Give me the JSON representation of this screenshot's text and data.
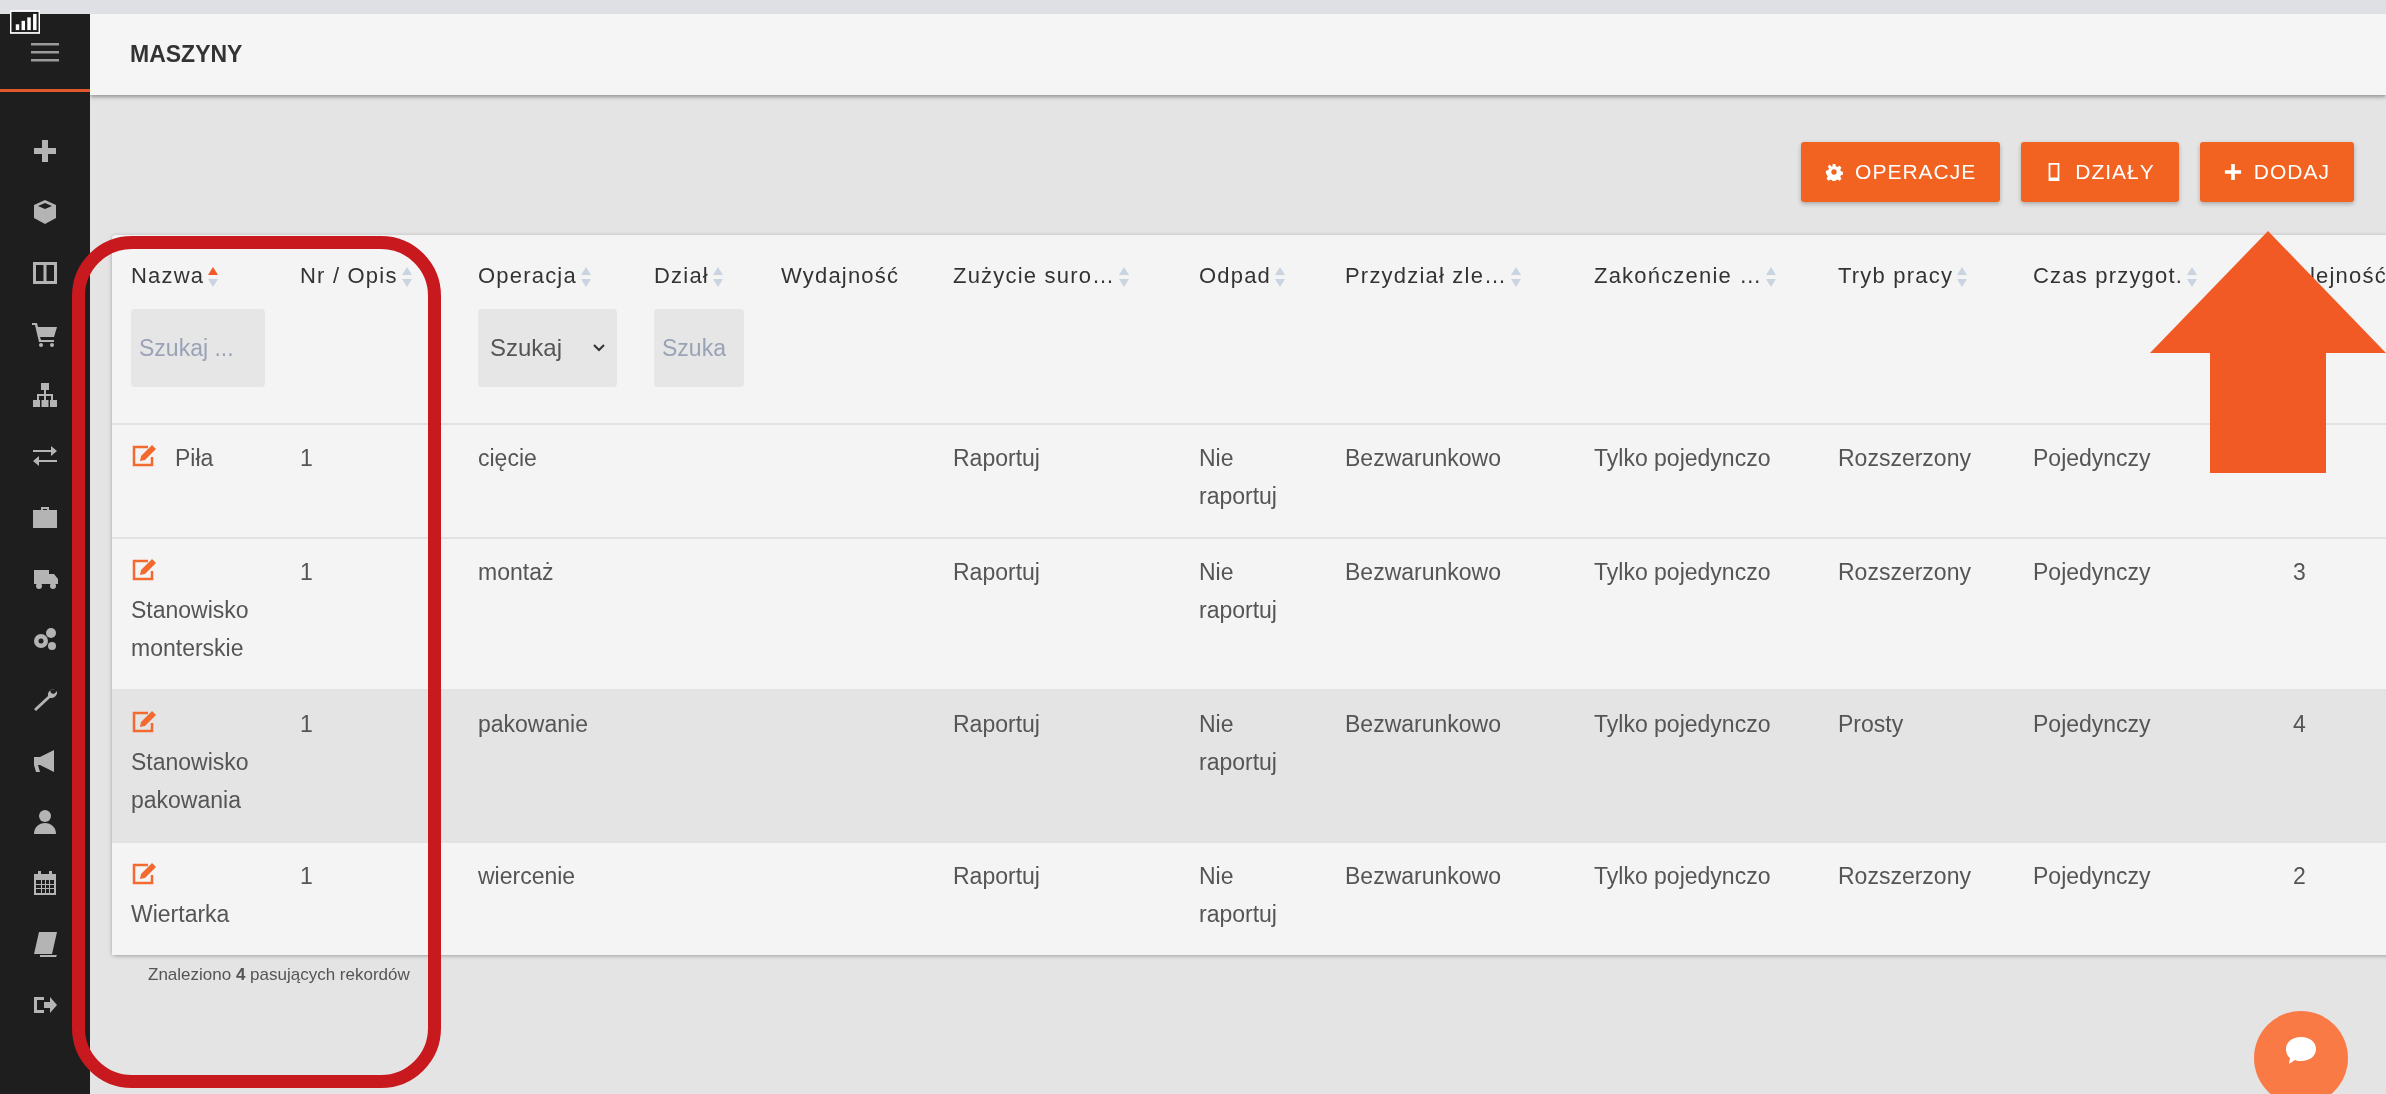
{
  "page": {
    "title": "MASZYNY"
  },
  "toolbar": {
    "buttons": [
      {
        "label": "OPERACJE",
        "kind": "gear"
      },
      {
        "label": "DZIAŁY",
        "kind": "tablet"
      },
      {
        "label": "DODAJ",
        "kind": "plus"
      }
    ]
  },
  "table": {
    "columns": [
      {
        "label": "Nazwa",
        "sorted": true,
        "filter": {
          "kind": "text",
          "placeholder": "Szukaj ..."
        }
      },
      {
        "label": "Nr / Opis",
        "sorted": false
      },
      {
        "label": "Operacja",
        "sorted": false,
        "filter": {
          "kind": "select",
          "value": "Szukaj"
        }
      },
      {
        "label": "Dział",
        "sorted": false,
        "filter": {
          "kind": "text",
          "placeholder": "Szuka"
        }
      },
      {
        "label": "Wydajność"
      },
      {
        "label": "Zużycie suro…",
        "sorted": false
      },
      {
        "label": "Odpad",
        "sorted": false
      },
      {
        "label": "Przydział zle…",
        "sorted": false
      },
      {
        "label": "Zakończenie …",
        "sorted": false
      },
      {
        "label": "Tryb pracy",
        "sorted": false
      },
      {
        "label": "Czas przygot.",
        "sorted": false
      },
      {
        "label": "lejność"
      }
    ],
    "rows": [
      {
        "highlighted": false,
        "name": "Piła",
        "nr_opis": "1",
        "operacja": "cięcie",
        "zuzycie_surowca": "Raportuj",
        "odpad": "Nie raportuj",
        "przydzial": "Bezwarunkowo",
        "zakonczenie": "Tylko pojedynczo",
        "tryb_pracy": "Rozszerzony",
        "czas_przygot": "Pojedynczy"
      },
      {
        "highlighted": false,
        "name": "Stanowisko monterskie",
        "nr_opis": "1",
        "operacja": "montaż",
        "zuzycie_surowca": "Raportuj",
        "odpad": "Nie raportuj",
        "przydzial": "Bezwarunkowo",
        "zakonczenie": "Tylko pojedynczo",
        "tryb_pracy": "Rozszerzony",
        "czas_przygot": "Pojedynczy",
        "kolejnosc": "3"
      },
      {
        "highlighted": true,
        "name": "Stanowisko pakowania",
        "nr_opis": "1",
        "operacja": "pakowanie",
        "zuzycie_surowca": "Raportuj",
        "odpad": "Nie raportuj",
        "przydzial": "Bezwarunkowo",
        "zakonczenie": "Tylko pojedynczo",
        "tryb_pracy": "Prosty",
        "czas_przygot": "Pojedynczy",
        "kolejnosc": "4"
      },
      {
        "highlighted": false,
        "name": "Wiertarka",
        "nr_opis": "1",
        "operacja": "wiercenie",
        "zuzycie_surowca": "Raportuj",
        "odpad": "Nie raportuj",
        "przydzial": "Bezwarunkowo",
        "zakonczenie": "Tylko pojedynczo",
        "tryb_pracy": "Rozszerzony",
        "czas_przygot": "Pojedynczy",
        "kolejnosc": "2"
      }
    ],
    "footer": "Znaleziono **4** pasujących rekordów"
  }
}
